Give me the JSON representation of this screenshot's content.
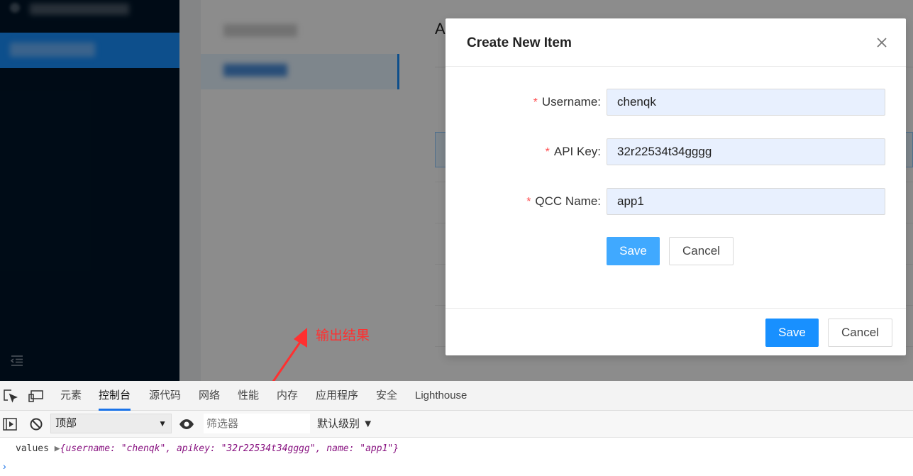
{
  "modal": {
    "title": "Create New Item",
    "close_icon": "close-icon",
    "fields": [
      {
        "label": "Username:",
        "value": "chenqk",
        "required": true
      },
      {
        "label": "API Key:",
        "value": "32r22534t34gggg",
        "required": true
      },
      {
        "label": "QCC Name:",
        "value": "app1",
        "required": true
      }
    ],
    "form_save_label": "Save",
    "form_cancel_label": "Cancel",
    "footer_save_label": "Save",
    "footer_cancel_label": "Cancel"
  },
  "content": {
    "heading_partial": "A"
  },
  "annotation": {
    "text": "输出结果",
    "color": "#ff3030"
  },
  "devtools": {
    "tabs": [
      "元素",
      "控制台",
      "源代码",
      "网络",
      "性能",
      "内存",
      "应用程序",
      "安全",
      "Lighthouse"
    ],
    "active_tab": "控制台",
    "context_select": "顶部",
    "filter_placeholder": "筛选器",
    "level_label": "默认级别",
    "log": {
      "label": "values",
      "object": "{username: \"chenqk\", apikey: \"32r22534t34gggg\", name: \"app1\"}"
    }
  },
  "colors": {
    "primary": "#1890ff",
    "sidebar_bg": "#001529",
    "required_star": "#ff4d4f"
  }
}
